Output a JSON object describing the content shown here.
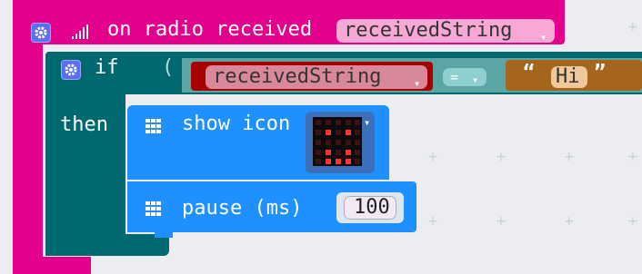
{
  "event": {
    "label": "on radio received",
    "param": "receivedString",
    "signal_icon": "signal-bars-icon",
    "gear_icon": "gear-icon"
  },
  "if_block": {
    "if_label": "if",
    "then_label": "then",
    "left_operand": "receivedString",
    "operator": "=",
    "right_operand": "Hi",
    "open_quote": "“",
    "close_quote": "”",
    "paren": "("
  },
  "show_icon": {
    "label": "show icon",
    "icon": "led-grid-icon"
  },
  "pause": {
    "label": "pause (ms)",
    "value": "100",
    "icon": "led-grid-icon"
  },
  "colors": {
    "radio": "#e3008c",
    "logic": "#006970",
    "variable": "#a80000",
    "text": "#a6651c",
    "basic": "#1e90ff",
    "compare": "#5ba5a5"
  }
}
